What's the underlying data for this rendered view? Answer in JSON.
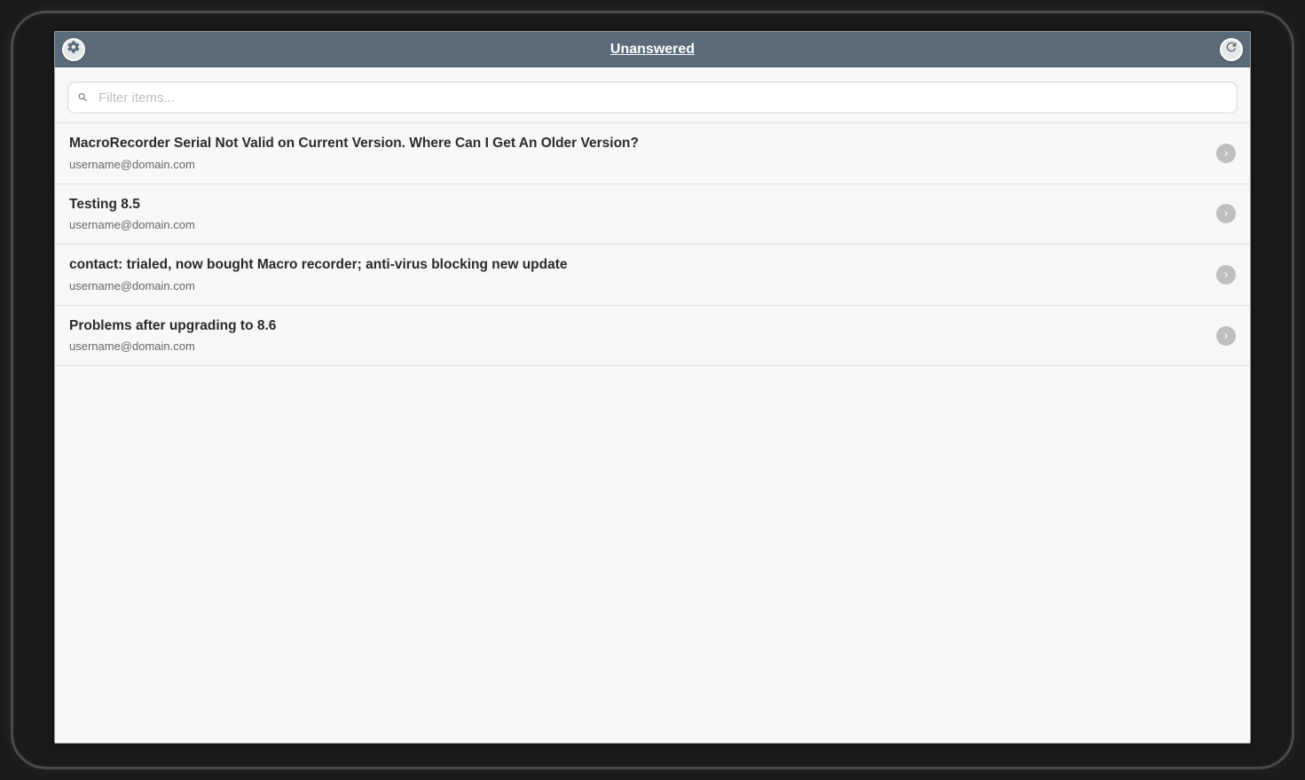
{
  "header": {
    "title": "Unanswered"
  },
  "search": {
    "placeholder": "Filter items...",
    "value": ""
  },
  "items": [
    {
      "title": "MacroRecorder Serial Not Valid on Current Version. Where Can I Get An Older Version?",
      "from": "username@domain.com"
    },
    {
      "title": "Testing 8.5",
      "from": "username@domain.com"
    },
    {
      "title": "contact: trialed, now bought Macro recorder; anti-virus blocking new update",
      "from": "username@domain.com"
    },
    {
      "title": "Problems after upgrading to 8.6",
      "from": "username@domain.com"
    }
  ]
}
